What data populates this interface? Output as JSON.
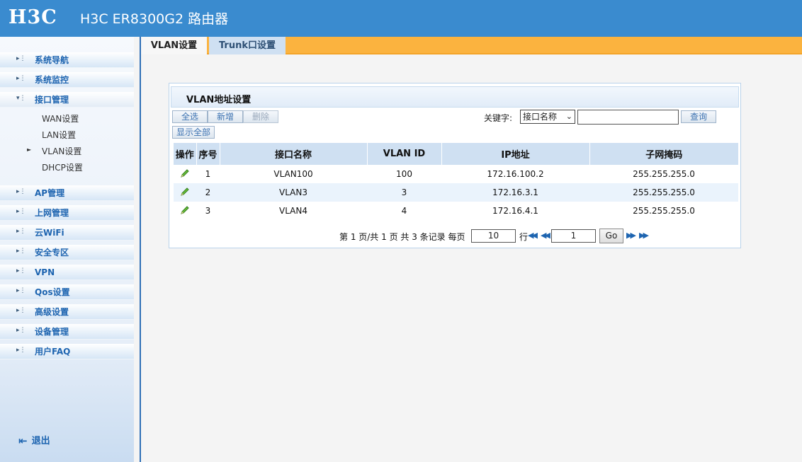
{
  "header": {
    "logo": "H3C",
    "model": "H3C ER8300G2 路由器"
  },
  "sidebar": {
    "items": [
      {
        "label": "系统导航"
      },
      {
        "label": "系统监控"
      },
      {
        "label": "接口管理"
      },
      {
        "label": "AP管理"
      },
      {
        "label": "上网管理"
      },
      {
        "label": "云WiFi"
      },
      {
        "label": "安全专区"
      },
      {
        "label": "VPN"
      },
      {
        "label": "Qos设置"
      },
      {
        "label": "高级设置"
      },
      {
        "label": "设备管理"
      },
      {
        "label": "用户FAQ"
      }
    ],
    "subitems": [
      {
        "label": "WAN设置"
      },
      {
        "label": "LAN设置"
      },
      {
        "label": "VLAN设置"
      },
      {
        "label": "DHCP设置"
      }
    ],
    "active_subitem": "VLAN设置",
    "logout": "退出"
  },
  "tabs": [
    {
      "label": "VLAN设置"
    },
    {
      "label": "Trunk口设置"
    }
  ],
  "panel": {
    "title": "VLAN地址设置",
    "buttons": {
      "select_all": "全选",
      "add": "新增",
      "delete": "删除",
      "show_all": "显示全部",
      "search": "查询"
    },
    "keyword_label": "关键字:",
    "keyword_select": "接口名称",
    "keyword_value": "",
    "columns": [
      "操作",
      "序号",
      "接口名称",
      "VLAN ID",
      "IP地址",
      "子网掩码"
    ],
    "rows": [
      {
        "index": "1",
        "name": "VLAN100",
        "vlan_id": "100",
        "ip": "172.16.100.2",
        "mask": "255.255.255.0"
      },
      {
        "index": "2",
        "name": "VLAN3",
        "vlan_id": "3",
        "ip": "172.16.3.1",
        "mask": "255.255.255.0"
      },
      {
        "index": "3",
        "name": "VLAN4",
        "vlan_id": "4",
        "ip": "172.16.4.1",
        "mask": "255.255.255.0"
      }
    ],
    "pager": {
      "summary": "第 1 页/共 1 页 共 3 条记录 每页",
      "per_page": "10",
      "rows_unit": "行",
      "page": "1",
      "go": "Go"
    }
  },
  "colors": {
    "header": "#3a8bcf",
    "tabbar": "#fbb33f",
    "nav_text": "#1d64b0",
    "table_header": "#cfe0f2"
  },
  "icons": {
    "edit": "pencil-icon",
    "first": "first-page-icon",
    "prev": "prev-page-icon",
    "next": "next-page-icon",
    "last": "last-page-icon",
    "logout": "logout-icon"
  }
}
